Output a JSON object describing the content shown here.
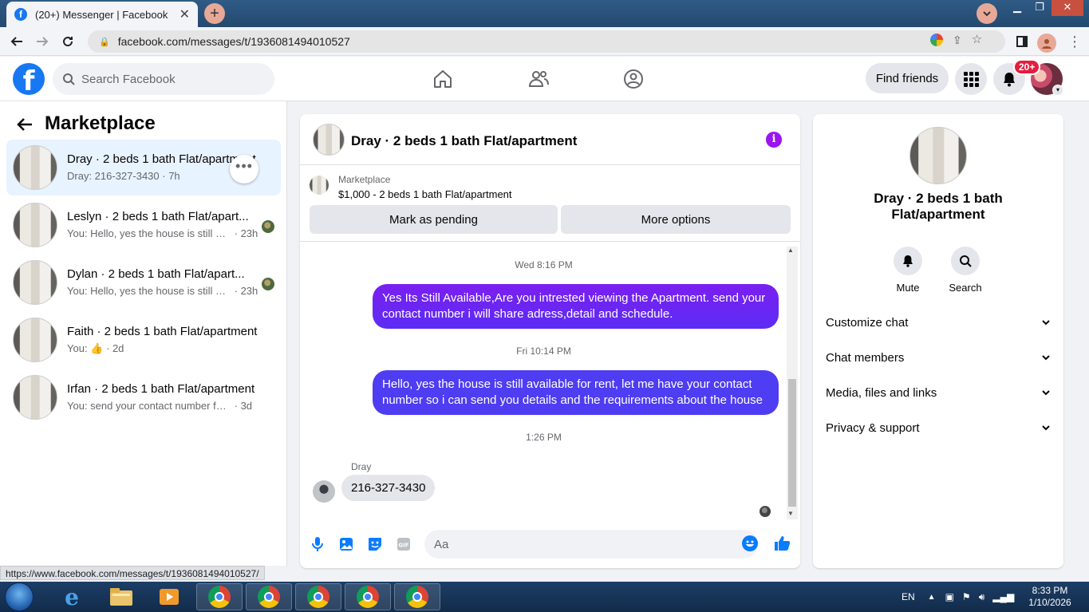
{
  "browser": {
    "tab_title": "(20+) Messenger | Facebook",
    "url": "facebook.com/messages/t/1936081494010527",
    "status_url": "https://www.facebook.com/messages/t/1936081494010527/"
  },
  "fb": {
    "search_placeholder": "Search Facebook",
    "find_friends": "Find friends",
    "notif_badge": "20+"
  },
  "sidebar": {
    "title": "Marketplace",
    "conversations": [
      {
        "name": "Dray · 2 beds 1 bath Flat/apartment",
        "preview": "Dray: 216-327-3430",
        "time": "7h"
      },
      {
        "name": "Leslyn · 2 beds 1 bath Flat/apart...",
        "preview": "You: Hello, yes the house is still av...",
        "time": "23h"
      },
      {
        "name": "Dylan · 2 beds 1 bath Flat/apart...",
        "preview": "You: Hello, yes the house is still av...",
        "time": "23h"
      },
      {
        "name": "Faith · 2 beds 1 bath Flat/apartment",
        "preview": "You:",
        "time": "2d"
      },
      {
        "name": "Irfan · 2 beds 1 bath Flat/apartment",
        "preview": "You: send your contact number for fu...",
        "time": "3d"
      }
    ]
  },
  "chat": {
    "title": "Dray · 2 beds 1 bath Flat/apartment",
    "marketplace_label": "Marketplace",
    "listing": "$1,000 - 2 beds 1 bath Flat/apartment",
    "mark_pending": "Mark as pending",
    "more_options": "More options",
    "messages": [
      {
        "timestamp": "Wed 8:16 PM",
        "text": "Yes Its Still Available,Are you intrested viewing the Apartment. send your contact number i will share adress,detail and schedule."
      },
      {
        "timestamp": "Fri 10:14 PM",
        "text": "Hello, yes the house is still available for rent, let me have your contact number so i can send you details and the requirements about the house"
      },
      {
        "timestamp": "1:26 PM",
        "sender": "Dray",
        "text": "216-327-3430"
      }
    ],
    "input_placeholder": "Aa"
  },
  "right": {
    "name": "Dray · 2 beds 1 bath Flat/apartment",
    "mute": "Mute",
    "search": "Search",
    "items": [
      "Customize chat",
      "Chat members",
      "Media, files and links",
      "Privacy & support"
    ]
  },
  "taskbar": {
    "lang": "EN",
    "time": "8:33 PM",
    "date": "1/10/2026"
  },
  "colors": {
    "fb_blue": "#1877f2",
    "outgoing_bubble": "#7a1ff0",
    "accent_purple": "#9a15f0"
  }
}
